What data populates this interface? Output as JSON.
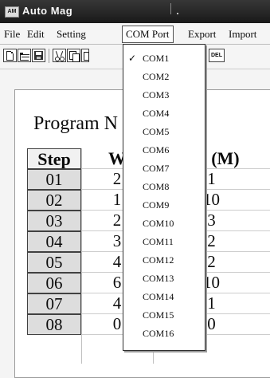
{
  "window": {
    "title": "Auto Mag",
    "icon_text": "AM"
  },
  "menu": [
    {
      "label": "File"
    },
    {
      "label": "Edit"
    },
    {
      "label": "Setting"
    },
    {
      "label": "COM Port"
    },
    {
      "label": "Export"
    },
    {
      "label": "Import"
    }
  ],
  "toolbar": {
    "buttons": [
      "new-file-icon",
      "open-folder-icon",
      "save-icon",
      "cut-icon",
      "copy-icon",
      "paste-icon",
      "delete-icon"
    ],
    "del_label": "DEL"
  },
  "main": {
    "program_label": "Program N",
    "columns": [
      "Step",
      "W",
      "ing (M)"
    ],
    "rows": [
      {
        "step": "01",
        "w": "2",
        "t": "1"
      },
      {
        "step": "02",
        "w": "1",
        "t": "10"
      },
      {
        "step": "03",
        "w": "2",
        "t": "3"
      },
      {
        "step": "04",
        "w": "3",
        "t": "2"
      },
      {
        "step": "05",
        "w": "4",
        "t": "2"
      },
      {
        "step": "06",
        "w": "6",
        "t": "10"
      },
      {
        "step": "07",
        "w": "4",
        "t": "1"
      },
      {
        "step": "08",
        "w": "0",
        "t": "0"
      }
    ]
  },
  "com_menu": {
    "checked_mark": "✓",
    "items": [
      "COM1",
      "COM2",
      "COM3",
      "COM4",
      "COM5",
      "COM6",
      "COM7",
      "COM8",
      "COM9",
      "COM10",
      "COM11",
      "COM12",
      "COM13",
      "COM14",
      "COM15",
      "COM16"
    ]
  }
}
